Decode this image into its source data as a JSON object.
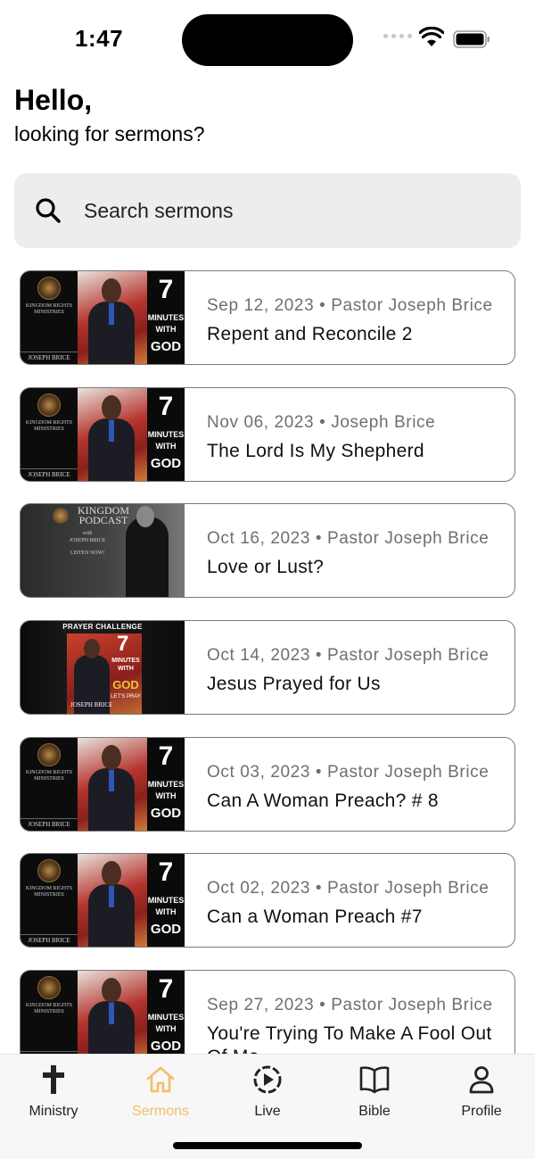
{
  "status_bar": {
    "time": "1:47"
  },
  "header": {
    "title": "Hello,",
    "subtitle": "looking for sermons?"
  },
  "search": {
    "placeholder": "Search sermons",
    "icon": "search-icon"
  },
  "sermons": [
    {
      "date": "Sep 12, 2023",
      "speaker": "Pastor Joseph Brice",
      "title": "Repent and Reconcile 2",
      "thumbnail": "seven-minutes"
    },
    {
      "date": "Nov 06, 2023",
      "speaker": "Joseph Brice",
      "title": "The Lord Is My Shepherd",
      "thumbnail": "seven-minutes"
    },
    {
      "date": "Oct 16, 2023",
      "speaker": "Pastor Joseph Brice",
      "title": "Love or Lust?",
      "thumbnail": "podcast"
    },
    {
      "date": "Oct 14, 2023",
      "speaker": "Pastor Joseph Brice",
      "title": "Jesus Prayed for Us",
      "thumbnail": "prayer"
    },
    {
      "date": "Oct 03, 2023",
      "speaker": "Pastor Joseph Brice",
      "title": "Can A Woman Preach? # 8",
      "thumbnail": "seven-minutes"
    },
    {
      "date": "Oct 02, 2023",
      "speaker": "Pastor Joseph Brice",
      "title": "Can a Woman Preach #7",
      "thumbnail": "seven-minutes"
    },
    {
      "date": "Sep 27, 2023",
      "speaker": "Pastor Joseph Brice",
      "title": "You're Trying To Make A Fool Out Of Me",
      "thumbnail": "seven-minutes"
    }
  ],
  "thumb_text": {
    "seven": "7",
    "minutes": "MINUTES",
    "with": "WITH",
    "god": "GOD",
    "ministry_line1": "KINGDOM RIGHTS",
    "ministry_line2": "MINISTRIES",
    "name": "JOSEPH BRICE",
    "podcast_line1": "KINGDOM",
    "podcast_line2": "PODCAST",
    "podcast_with": "with",
    "podcast_name": "JOSEPH BRICE",
    "listen": "LISTEN NOW!",
    "prayer_challenge": "PRAYER CHALLENGE",
    "lets_pray": "LET'S PRAY"
  },
  "tabs": [
    {
      "label": "Ministry",
      "icon": "cross-icon",
      "active": false
    },
    {
      "label": "Sermons",
      "icon": "home-icon",
      "active": true
    },
    {
      "label": "Live",
      "icon": "play-circle-icon",
      "active": false
    },
    {
      "label": "Bible",
      "icon": "book-open-icon",
      "active": false
    },
    {
      "label": "Profile",
      "icon": "person-icon",
      "active": false
    }
  ],
  "colors": {
    "active_tab": "#f0c066",
    "search_bg": "#ededed",
    "meta_text": "#6f6f6f"
  }
}
